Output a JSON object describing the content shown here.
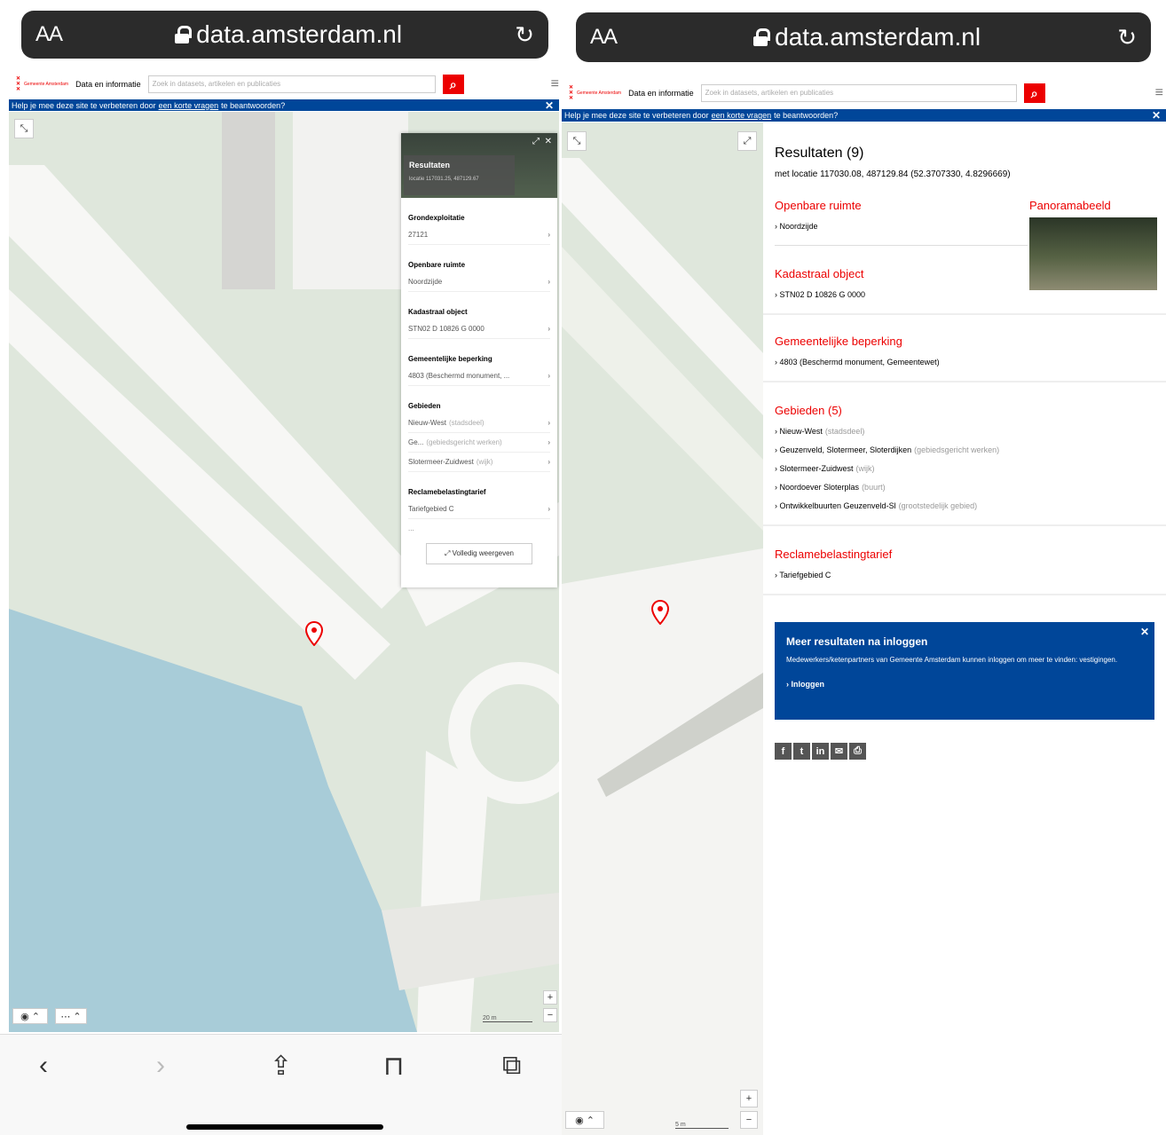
{
  "browser": {
    "text_size": "AA",
    "domain": "data.amsterdam.nl"
  },
  "site": {
    "logo_text": "Gemeente Amsterdam",
    "name": "Data en informatie",
    "search_placeholder": "Zoek in datasets, artikelen en publicaties",
    "help_prefix": "Help je mee deze site te verbeteren door",
    "help_link": "een korte vragen",
    "help_suffix": "te beantwoorden?",
    "help_close": "✕"
  },
  "map": {
    "zoom_in": "+",
    "zoom_out": "−",
    "scale_left": "20 m",
    "scale_right": "5 m"
  },
  "left_popup": {
    "title": "Resultaten",
    "location": "locatie 117031.25, 487129.67",
    "sections": [
      {
        "heading": "Grondexploitatie",
        "rows": [
          {
            "text": "27121",
            "extra": ""
          }
        ]
      },
      {
        "heading": "Openbare ruimte",
        "rows": [
          {
            "text": "Noordzijde",
            "extra": ""
          }
        ]
      },
      {
        "heading": "Kadastraal object",
        "rows": [
          {
            "text": "STN02 D 10826 G 0000",
            "extra": ""
          }
        ]
      },
      {
        "heading": "Gemeentelijke beperking",
        "rows": [
          {
            "text": "4803 (Beschermd monument, ...",
            "extra": ""
          }
        ]
      },
      {
        "heading": "Gebieden",
        "rows": [
          {
            "text": "Nieuw-West",
            "extra": "(stadsdeel)"
          },
          {
            "text": "Ge...",
            "extra": "(gebiedsgericht werken)"
          },
          {
            "text": "Slotermeer-Zuidwest",
            "extra": "(wijk)"
          }
        ]
      },
      {
        "heading": "Reclamebelastingtarief",
        "rows": [
          {
            "text": "Tariefgebied C",
            "extra": ""
          }
        ]
      }
    ],
    "more": "...",
    "full_button": "Volledig weergeven"
  },
  "results": {
    "title": "Resultaten (9)",
    "location": "met locatie 117030.08, 487129.84 (52.3707330, 4.8296669)",
    "panorama_heading": "Panoramabeeld",
    "openbare_heading": "Openbare ruimte",
    "openbare_item": "Noordzijde",
    "kadastraal_heading": "Kadastraal object",
    "kadastraal_item": "STN02 D 10826 G 0000",
    "beperking_heading": "Gemeentelijke beperking",
    "beperking_item": "4803 (Beschermd monument, Gemeentewet)",
    "gebieden_heading": "Gebieden (5)",
    "gebieden": [
      {
        "name": "Nieuw-West",
        "type": "(stadsdeel)"
      },
      {
        "name": "Geuzenveld, Slotermeer, Sloterdijken",
        "type": "(gebiedsgericht werken)"
      },
      {
        "name": "Slotermeer-Zuidwest",
        "type": "(wijk)"
      },
      {
        "name": "Noordoever Sloterplas",
        "type": "(buurt)"
      },
      {
        "name": "Ontwikkelbuurten Geuzenveld-Sl",
        "type": "(grootstedelijk gebied)"
      }
    ],
    "reclame_heading": "Reclamebelastingtarief",
    "reclame_item": "Tariefgebied C",
    "login_title": "Meer resultaten na inloggen",
    "login_text": "Medewerkers/ketenpartners van Gemeente Amsterdam kunnen inloggen om meer te vinden: vestigingen.",
    "login_link": "Inloggen",
    "login_close": "✕"
  },
  "social": [
    "f",
    "t",
    "in",
    "✉",
    "⎙"
  ]
}
